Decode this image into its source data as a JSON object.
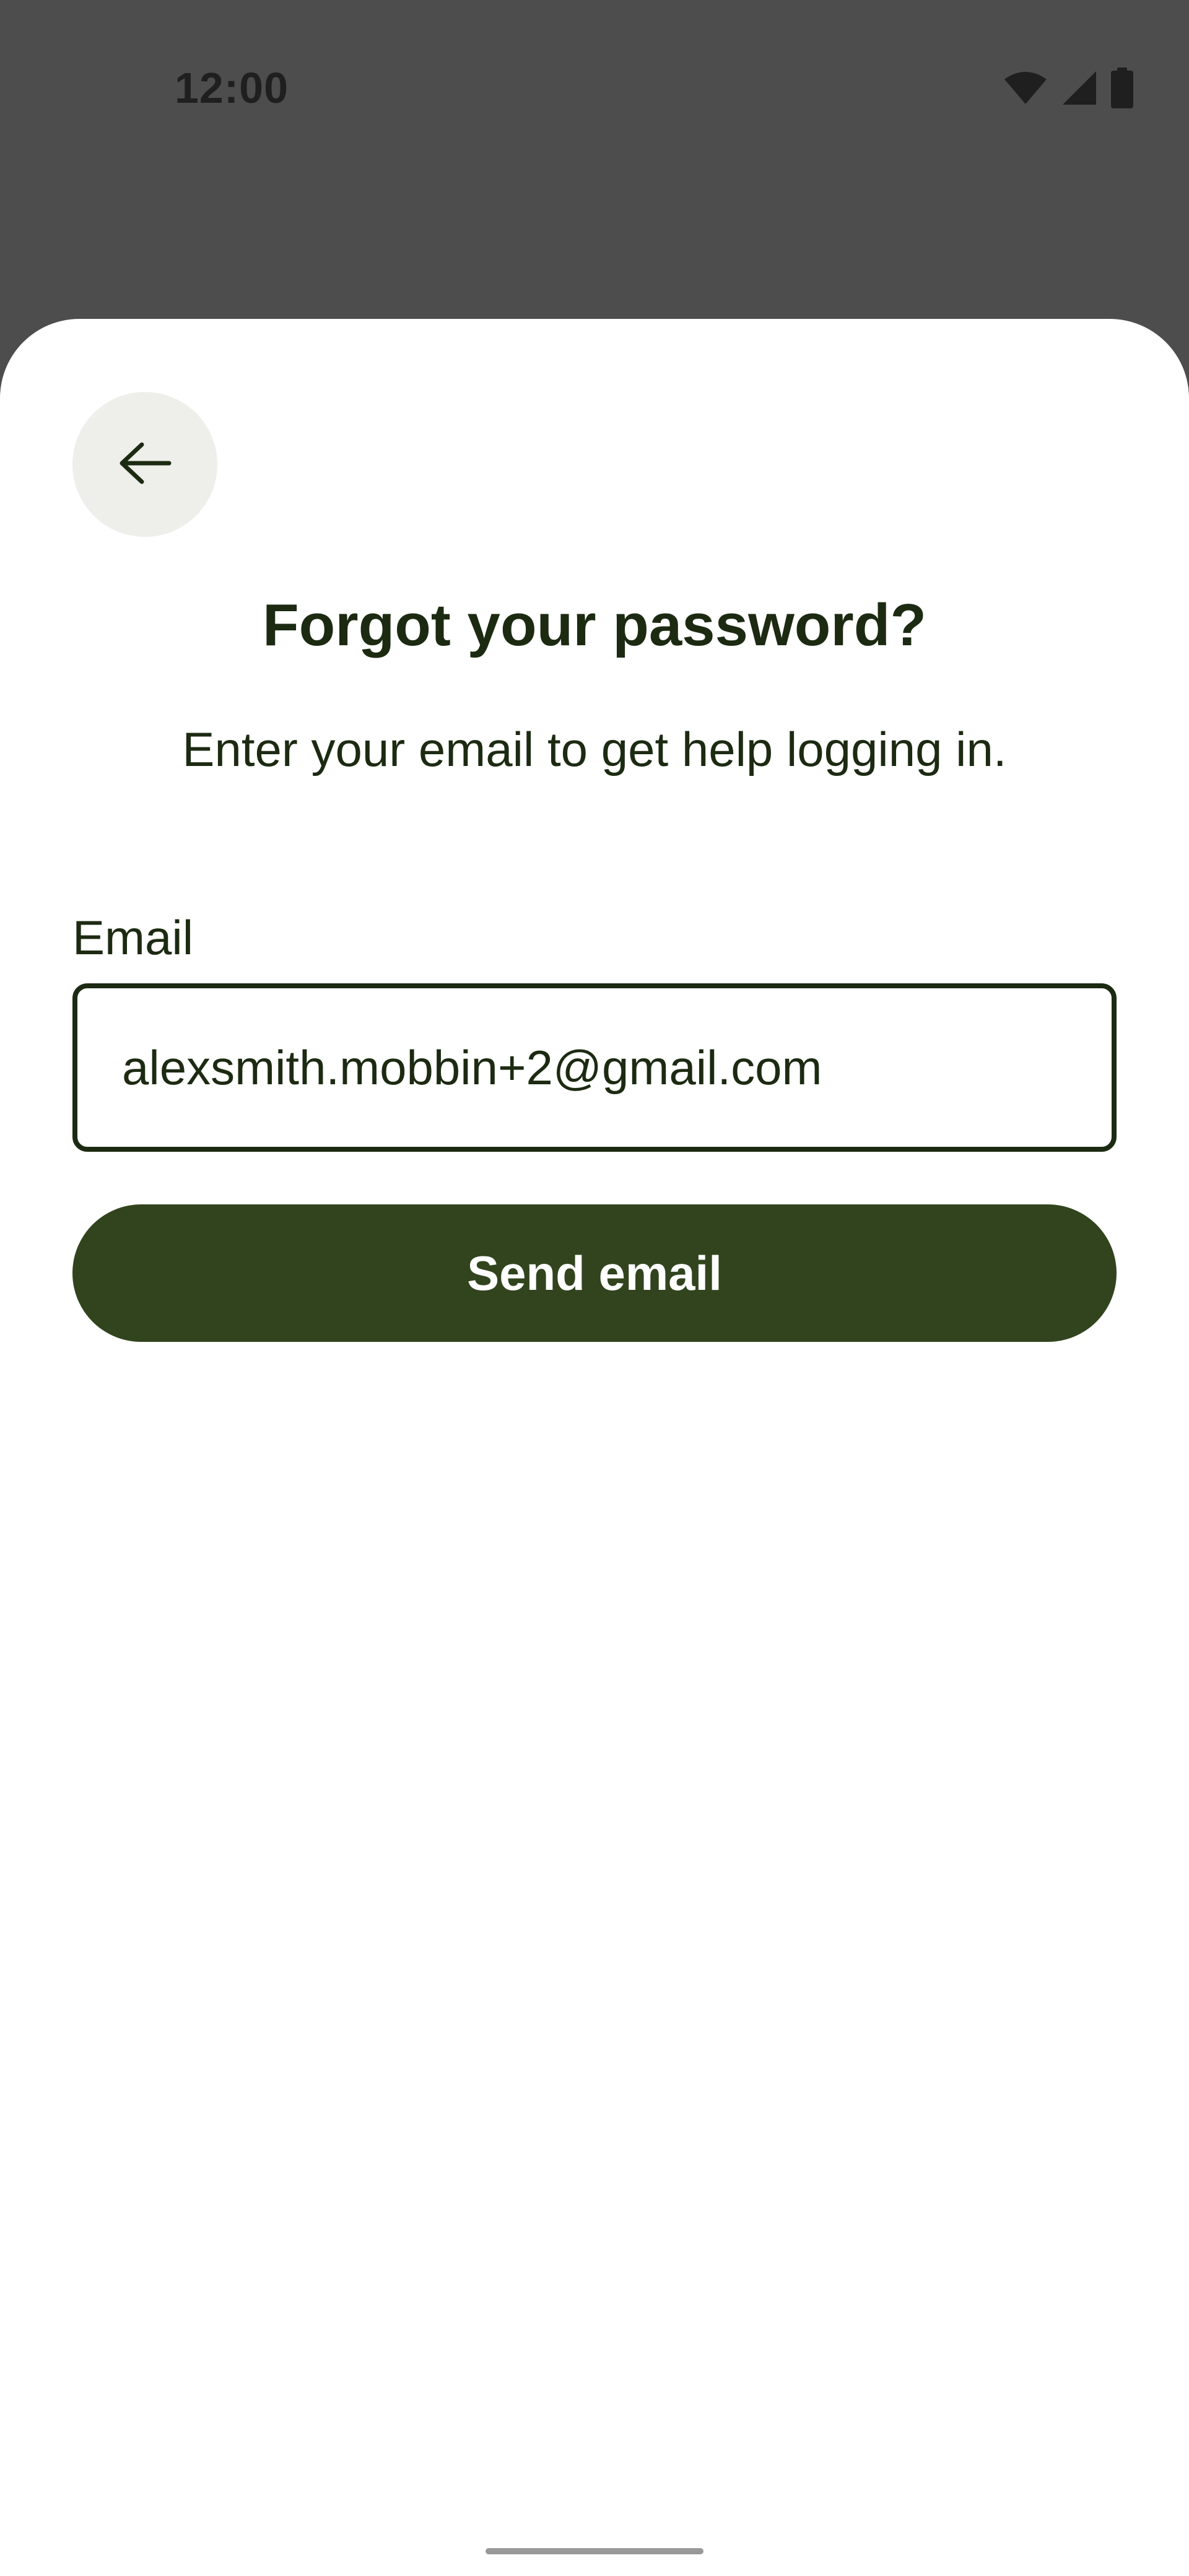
{
  "status_bar": {
    "time": "12:00",
    "icons": [
      "wifi-icon",
      "cellular-signal-icon",
      "battery-icon"
    ]
  },
  "header": {
    "back_icon": "arrow-left-icon"
  },
  "main": {
    "title": "Forgot your password?",
    "subtitle": "Enter your email to get help logging in."
  },
  "form": {
    "email_label": "Email",
    "email_value": "alexsmith.mobbin+2@gmail.com",
    "submit_label": "Send email"
  },
  "colors": {
    "overlay": "#4d4d4d",
    "sheet": "#ffffff",
    "text": "#1c2a12",
    "primary_button": "#31441e",
    "back_button_bg": "#eeeeea"
  }
}
